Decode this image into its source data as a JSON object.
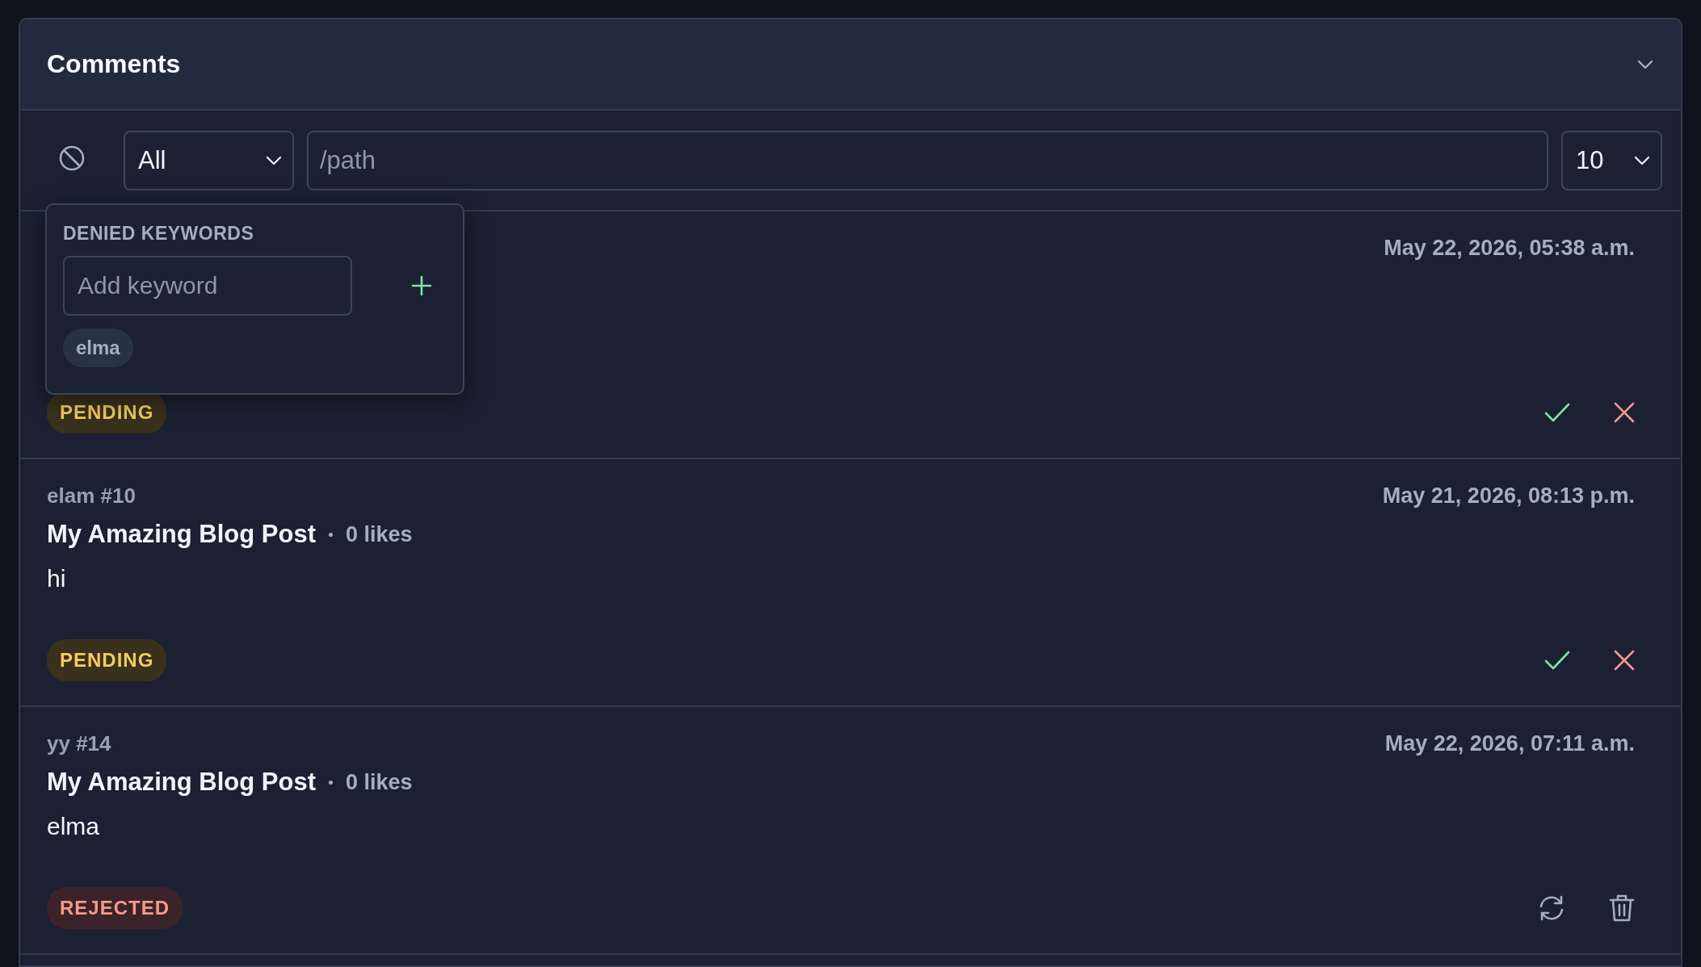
{
  "panel": {
    "title": "Comments"
  },
  "filters": {
    "status_select": {
      "value": "All"
    },
    "path_field": {
      "placeholder": "/path"
    },
    "page_size_select": {
      "value": "10"
    }
  },
  "denied_keywords": {
    "title": "DENIED KEYWORDS",
    "input": {
      "placeholder": "Add keyword"
    },
    "keywords": [
      "elma"
    ]
  },
  "comments": [
    {
      "date": "May 22, 2026, 05:38 a.m.",
      "status": {
        "label": "PENDING",
        "kind": "pending"
      }
    },
    {
      "author": "elam #10",
      "date": "May 21, 2026, 08:13 p.m.",
      "post": "My Amazing Blog Post",
      "likes": "0 likes",
      "body": "hi",
      "status": {
        "label": "PENDING",
        "kind": "pending"
      }
    },
    {
      "author": "yy #14",
      "date": "May 22, 2026, 07:11 a.m.",
      "post": "My Amazing Blog Post",
      "likes": "0 likes",
      "body": "elma",
      "status": {
        "label": "REJECTED",
        "kind": "rejected"
      }
    }
  ]
}
